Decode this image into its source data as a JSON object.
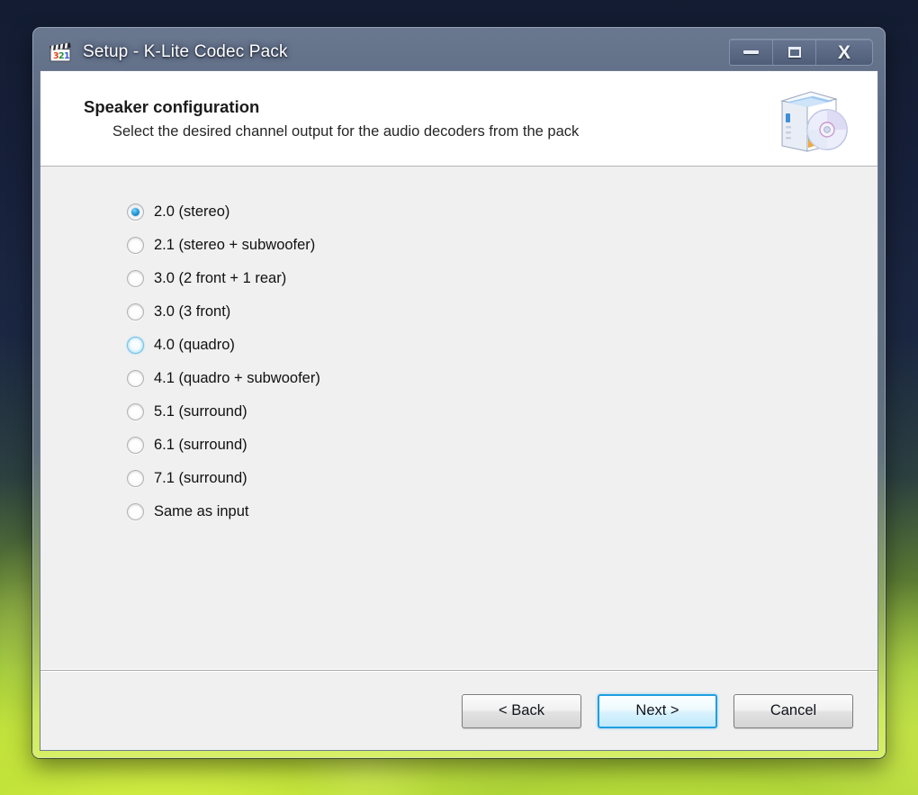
{
  "window": {
    "title": "Setup - K-Lite Codec Pack",
    "app_icon": "film-clapperboard-321-icon",
    "controls": {
      "minimize_label": "Minimize",
      "maximize_label": "Maximize",
      "close_label": "X"
    }
  },
  "header": {
    "title": "Speaker configuration",
    "subtitle": "Select the desired channel output for the audio decoders from the pack",
    "icon": "software-box-with-cd-icon"
  },
  "options": [
    {
      "label": "2.0 (stereo)",
      "checked": true,
      "hover": false
    },
    {
      "label": "2.1 (stereo + subwoofer)",
      "checked": false,
      "hover": false
    },
    {
      "label": "3.0 (2 front + 1 rear)",
      "checked": false,
      "hover": false
    },
    {
      "label": "3.0 (3 front)",
      "checked": false,
      "hover": false
    },
    {
      "label": "4.0 (quadro)",
      "checked": false,
      "hover": true
    },
    {
      "label": "4.1 (quadro + subwoofer)",
      "checked": false,
      "hover": false
    },
    {
      "label": "5.1 (surround)",
      "checked": false,
      "hover": false
    },
    {
      "label": "6.1 (surround)",
      "checked": false,
      "hover": false
    },
    {
      "label": "7.1 (surround)",
      "checked": false,
      "hover": false
    },
    {
      "label": "Same as input",
      "checked": false,
      "hover": false
    }
  ],
  "footer": {
    "back_label": "< Back",
    "next_label": "Next >",
    "cancel_label": "Cancel"
  },
  "colors": {
    "titlebar": "#1d2841",
    "accent_blue": "#1f9fe0",
    "radio_selected": "#2c9ddb",
    "body_gray": "#f0f0f0",
    "desktop_green": "#c2e043",
    "desktop_navy": "#141d33"
  }
}
